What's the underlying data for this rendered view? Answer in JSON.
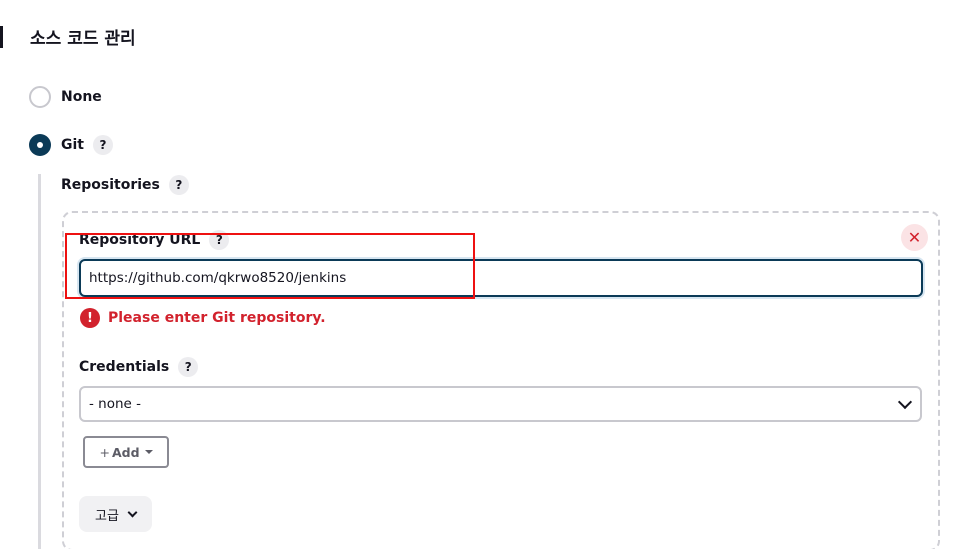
{
  "section": {
    "title": "소스 코드 관리"
  },
  "scm": {
    "options": [
      {
        "label": "None",
        "checked": false
      },
      {
        "label": "Git",
        "checked": true
      }
    ],
    "help_glyph": "?"
  },
  "git": {
    "repositories_label": "Repositories",
    "repository": {
      "close_icon": "✕",
      "url_label": "Repository URL",
      "url_value": "https://github.com/qkrwo8520/jenkins",
      "error_icon": "!",
      "error_text": "Please enter Git repository.",
      "credentials_label": "Credentials",
      "credentials_selected": "- none -",
      "add_button": {
        "plus": "+",
        "label": "Add"
      },
      "advanced_label": "고급"
    }
  },
  "colors": {
    "accent": "#0b3a57",
    "error": "#d2222d",
    "highlight": "#ee1111"
  }
}
